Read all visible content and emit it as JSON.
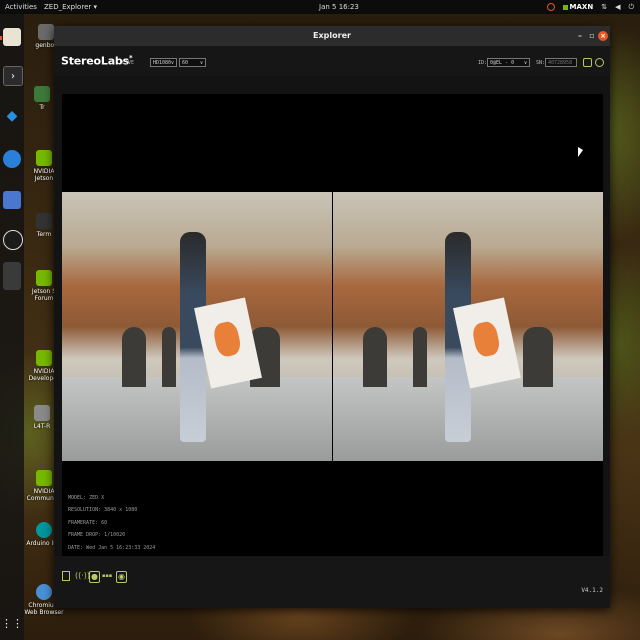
{
  "topbar": {
    "activities": "Activities",
    "app_menu": "ZED_Explorer ▾",
    "clock": "Jan 5  16:23",
    "power_mode": "MAXN"
  },
  "desktop": {
    "icons": [
      {
        "label": "genbot",
        "color": "#6b6b6b"
      },
      {
        "label": "Tr",
        "color": "#3c7a3c"
      },
      {
        "label": "NVIDIA Jetson",
        "color": "#76b900"
      },
      {
        "label": "Term",
        "color": "#333333"
      },
      {
        "label": "Jetson S Forum",
        "color": "#76b900"
      },
      {
        "label": "NVIDIA Developer",
        "color": "#76b900"
      },
      {
        "label": "L4T-R",
        "color": "#8a8a8a"
      },
      {
        "label": "NVIDIA Community",
        "color": "#76b900"
      },
      {
        "label": "Arduino IDE",
        "color": "#00979d"
      },
      {
        "label": "Chromium Web Browser",
        "color": "#4a90d9"
      }
    ]
  },
  "window": {
    "title": "Explorer",
    "minimize": "–",
    "maximize": "▫",
    "close": "×",
    "brand": "StereoLabs",
    "brand_mark": "*",
    "live": "LIVE",
    "resolution_select": "HD1080",
    "fps_select": "60",
    "id_label": "ID:",
    "id_value": "0@EL - 0",
    "sn_label": "SN:",
    "sn_value": "40728958",
    "version": "V4.1.2"
  },
  "overlay": {
    "model": "MODEL: ZED X",
    "resolution": "RESOLUTION: 3840 x 1080",
    "framerate": "FRAMERATE: 60",
    "frame_drop": "FRAME DROP: 1/10020",
    "date": "DATE: Wed Jan 5 16:23:33 2024"
  },
  "colors": {
    "accent": "#b8c960",
    "close": "#e95420",
    "nvidia": "#76b900"
  },
  "bottom_icons": [
    "folder-icon",
    "broadcast-icon",
    "record-icon",
    "depth-icon",
    "camera-icon"
  ]
}
